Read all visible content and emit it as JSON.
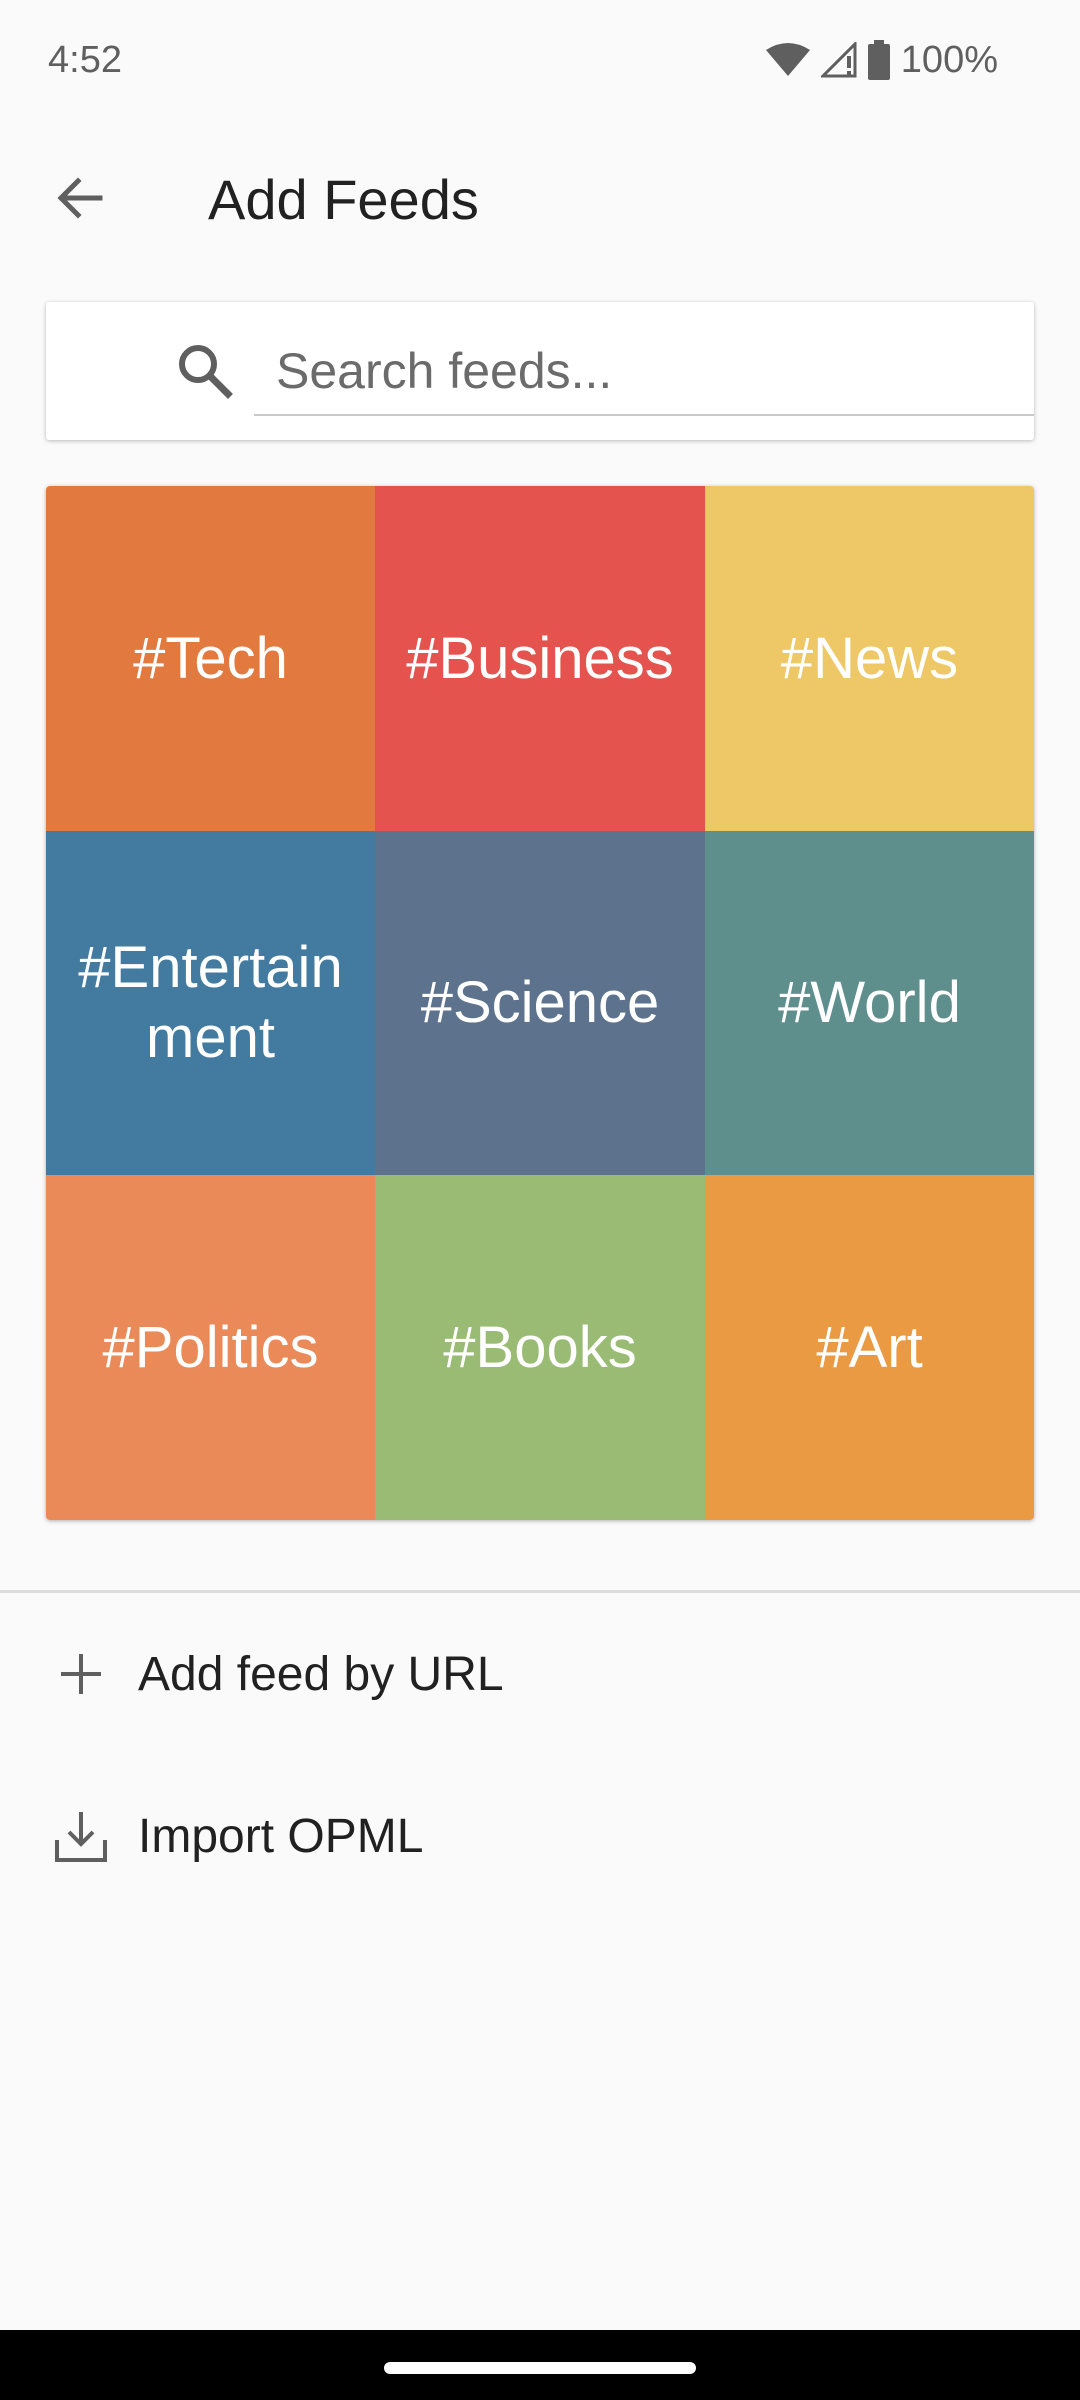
{
  "status_bar": {
    "time": "4:52",
    "battery": "100%",
    "icons": [
      "wifi-icon",
      "signal-icon",
      "battery-icon"
    ]
  },
  "app_bar": {
    "back_icon": "arrow-left-icon",
    "title": "Add Feeds"
  },
  "search": {
    "icon": "search-icon",
    "placeholder": "Search feeds...",
    "value": ""
  },
  "tags": [
    {
      "label": "#Tech",
      "color": "#e2793f"
    },
    {
      "label": "#Business",
      "color": "#e5534e"
    },
    {
      "label": "#News",
      "color": "#eec866"
    },
    {
      "label": "#Entertainment",
      "color": "#427b9f"
    },
    {
      "label": "#Science",
      "color": "#5d728c"
    },
    {
      "label": "#World",
      "color": "#5f8f8c"
    },
    {
      "label": "#Politics",
      "color": "#ea8a59"
    },
    {
      "label": "#Books",
      "color": "#99bb74"
    },
    {
      "label": "#Art",
      "color": "#e99a42"
    }
  ],
  "actions": [
    {
      "icon": "plus-icon",
      "label": "Add feed by URL"
    },
    {
      "icon": "download-icon",
      "label": "Import OPML"
    }
  ]
}
